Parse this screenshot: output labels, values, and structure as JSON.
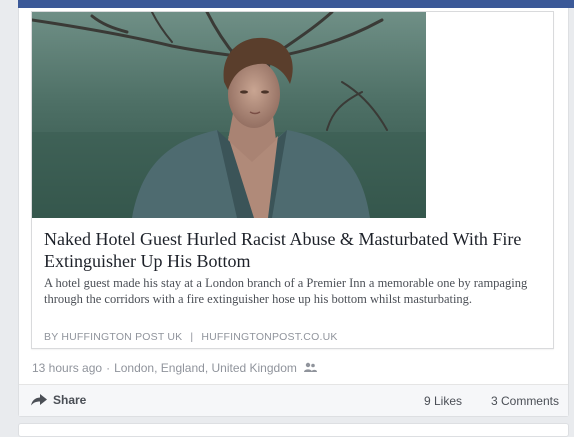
{
  "link_card": {
    "image_icon": "portrait-photo",
    "headline": "Naked Hotel Guest Hurled Racist Abuse & Masturbated With Fire Extinguisher Up His Bottom",
    "summary": "A hotel guest made his stay at a London branch of a Premier Inn a memorable one by rampaging through the corridors with a fire extinguisher hose up his bottom whilst masturbating.",
    "author": "BY HUFFINGTON POST UK",
    "separator": "|",
    "domain": "HUFFINGTONPOST.CO.UK"
  },
  "post_meta": {
    "time": "13 hours ago",
    "dot": "·",
    "location": "London, England, United Kingdom",
    "audience_icon": "friends-icon"
  },
  "actions": {
    "share_label": "Share",
    "share_icon": "share-arrow-icon",
    "likes": "9 Likes",
    "comments": "3 Comments"
  },
  "colors": {
    "brand": "#3b5998",
    "page_bg": "#e9ebee",
    "text": "#1d2129",
    "muted": "#90949c"
  }
}
